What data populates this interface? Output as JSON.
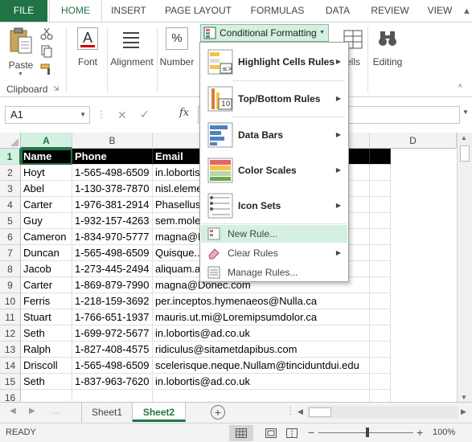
{
  "ribbon_tabs": [
    {
      "label": "FILE"
    },
    {
      "label": "HOME"
    },
    {
      "label": "INSERT"
    },
    {
      "label": "PAGE LAYOUT"
    },
    {
      "label": "FORMULAS"
    },
    {
      "label": "DATA"
    },
    {
      "label": "REVIEW"
    },
    {
      "label": "VIEW"
    }
  ],
  "ribbon": {
    "clipboard": {
      "paste_label": "Paste",
      "group_label": "Clipboard"
    },
    "font_label": "Font",
    "alignment_label": "Alignment",
    "number_label": "Number",
    "cells_label": "ells",
    "editing_label": "Editing",
    "conditional_formatting_label": "Conditional Formatting",
    "accent": "#217346"
  },
  "formula_bar": {
    "name_box": "A1",
    "fx_label": "fx"
  },
  "columns": [
    "A",
    "B",
    "C",
    "D"
  ],
  "rows": [
    {
      "n": "1",
      "name": "Name",
      "phone": "Phone",
      "email": "Email"
    },
    {
      "n": "2",
      "name": "Hoyt",
      "phone": "1-565-498-6509",
      "email": "in.lobortis@ad.co.uk"
    },
    {
      "n": "3",
      "name": "Abel",
      "phone": "1-130-378-7870",
      "email": "nisl.elementum@..."
    },
    {
      "n": "4",
      "name": "Carter",
      "phone": "1-976-381-2914",
      "email": "Phasellus...com"
    },
    {
      "n": "5",
      "name": "Guy",
      "phone": "1-932-157-4263",
      "email": "sem.molestie@..."
    },
    {
      "n": "6",
      "name": "Cameron",
      "phone": "1-834-970-5777",
      "email": "magna@Donec.com"
    },
    {
      "n": "7",
      "name": "Duncan",
      "phone": "1-565-498-6509",
      "email": "Quisque...co.uk"
    },
    {
      "n": "8",
      "name": "Jacob",
      "phone": "1-273-445-2494",
      "email": "aliquam.arcu@..."
    },
    {
      "n": "9",
      "name": "Carter",
      "phone": "1-869-879-7990",
      "email": "magna@Donec.com"
    },
    {
      "n": "10",
      "name": "Ferris",
      "phone": "1-218-159-3692",
      "email": "per.inceptos.hymenaeos@Nulla.ca"
    },
    {
      "n": "11",
      "name": "Stuart",
      "phone": "1-766-651-1937",
      "email": "mauris.ut.mi@Loremipsumdolor.ca"
    },
    {
      "n": "12",
      "name": "Seth",
      "phone": "1-699-972-5677",
      "email": "in.lobortis@ad.co.uk"
    },
    {
      "n": "13",
      "name": "Ralph",
      "phone": "1-827-408-4575",
      "email": "ridiculus@sitametdapibus.com"
    },
    {
      "n": "14",
      "name": "Driscoll",
      "phone": "1-565-498-6509",
      "email": "scelerisque.neque.Nullam@tinciduntdui.edu"
    },
    {
      "n": "15",
      "name": "Seth",
      "phone": "1-837-963-7620",
      "email": "in.lobortis@ad.co.uk"
    },
    {
      "n": "16",
      "name": "",
      "phone": "",
      "email": ""
    }
  ],
  "visible_email_fragments": {
    "r3": "nisl.elem",
    "r4": "Phasellus",
    "r4_tail": ".com",
    "r5": "sem.mole",
    "r6": "magna@",
    "r7": "Quisque.",
    "r7_tail": "o.uk",
    "r8": "aliquam.a",
    "r9": "magna@Donec.com"
  },
  "cf_menu": {
    "items": [
      {
        "label": "Highlight Cells Rules",
        "type": "big"
      },
      {
        "label": "Top/Bottom Rules",
        "type": "big"
      },
      {
        "label": "Data Bars",
        "type": "big"
      },
      {
        "label": "Color Scales",
        "type": "big"
      },
      {
        "label": "Icon Sets",
        "type": "big"
      },
      {
        "label": "New Rule...",
        "type": "small"
      },
      {
        "label": "Clear Rules",
        "type": "small"
      },
      {
        "label": "Manage Rules...",
        "type": "small"
      }
    ],
    "topbottom_badge": "10"
  },
  "sheets": [
    {
      "label": "Sheet1",
      "active": false
    },
    {
      "label": "Sheet2",
      "active": true
    }
  ],
  "status": {
    "ready": "READY",
    "zoom": "100%"
  }
}
